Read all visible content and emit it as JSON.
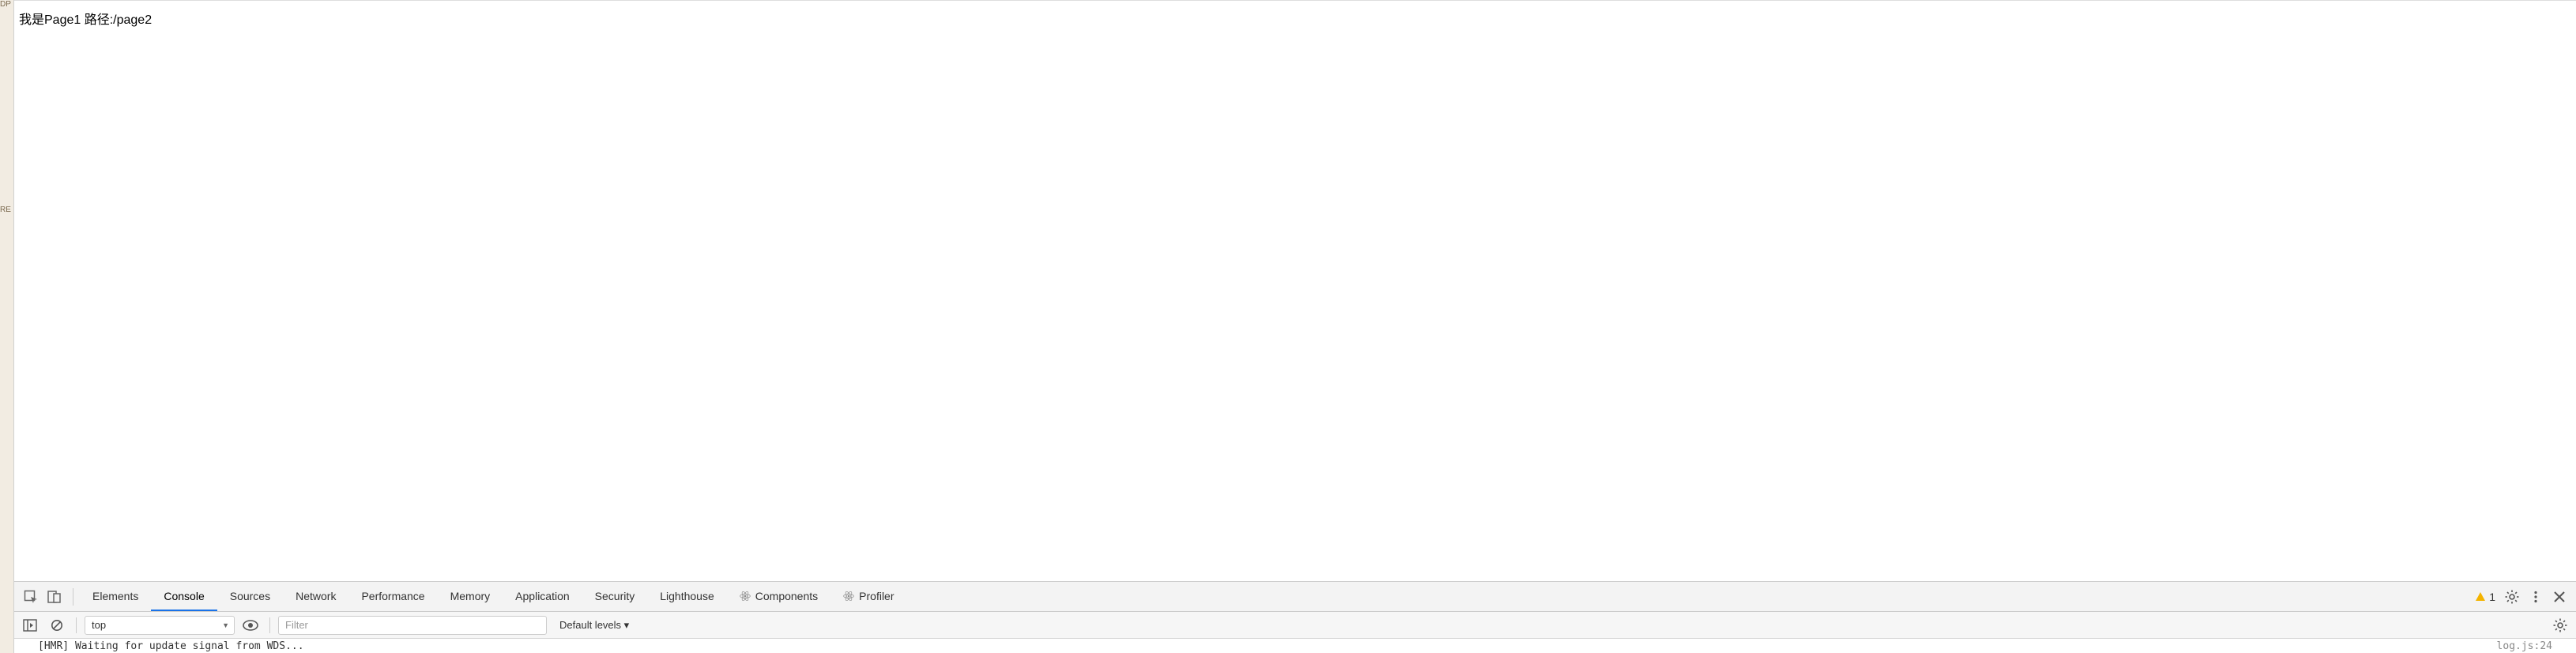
{
  "edge": {
    "label1": "DP",
    "label2": "RE"
  },
  "page": {
    "content": "我是Page1 路径:/page2"
  },
  "devtools": {
    "tabs": [
      {
        "label": "Elements"
      },
      {
        "label": "Console"
      },
      {
        "label": "Sources"
      },
      {
        "label": "Network"
      },
      {
        "label": "Performance"
      },
      {
        "label": "Memory"
      },
      {
        "label": "Application"
      },
      {
        "label": "Security"
      },
      {
        "label": "Lighthouse"
      },
      {
        "label": "Components"
      },
      {
        "label": "Profiler"
      }
    ],
    "activeTab": "Console",
    "warnings": "1",
    "consoleBar": {
      "context": "top",
      "filterPlaceholder": "Filter",
      "levels": "Default levels ▾"
    },
    "log": {
      "message": "[HMR] Waiting for update signal from WDS...",
      "source": "log.js:24"
    }
  }
}
